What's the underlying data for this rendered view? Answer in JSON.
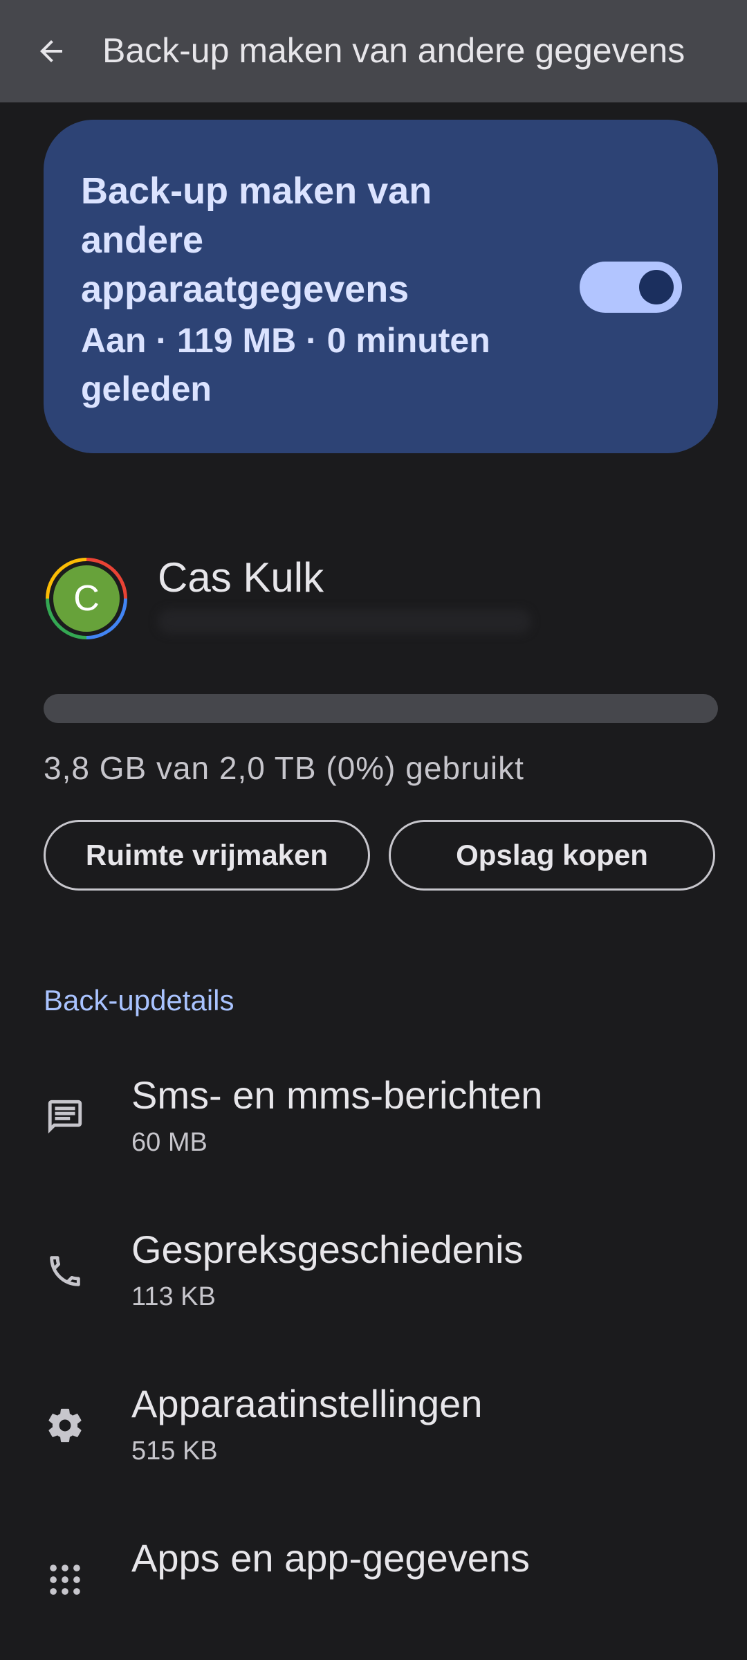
{
  "appbar": {
    "title": "Back-up maken van andere gegevens"
  },
  "backup_card": {
    "title": "Back-up maken van andere apparaatgegevens",
    "status": "Aan · 119 MB · 0 minuten geleden",
    "toggle_on": true
  },
  "account": {
    "avatar_letter": "C",
    "name": "Cas Kulk"
  },
  "storage": {
    "used_fraction": 0.0,
    "summary": "3,8 GB van 2,0 TB (0%) gebruikt",
    "free_button": "Ruimte vrijmaken",
    "buy_button": "Opslag kopen"
  },
  "details": {
    "header": "Back-updetails",
    "items": [
      {
        "icon": "message-icon",
        "title": "Sms- en mms-berichten",
        "size": "60 MB"
      },
      {
        "icon": "phone-icon",
        "title": "Gespreksgeschiedenis",
        "size": "113 KB"
      },
      {
        "icon": "gear-icon",
        "title": "Apparaatinstellingen",
        "size": "515 KB"
      },
      {
        "icon": "apps-grid-icon",
        "title": "Apps en app-gegevens"
      }
    ]
  },
  "colors": {
    "appbar_bg": "#46474c",
    "card_bg": "#2d4375",
    "accent": "#b2c5ff",
    "background": "#1b1b1d"
  }
}
